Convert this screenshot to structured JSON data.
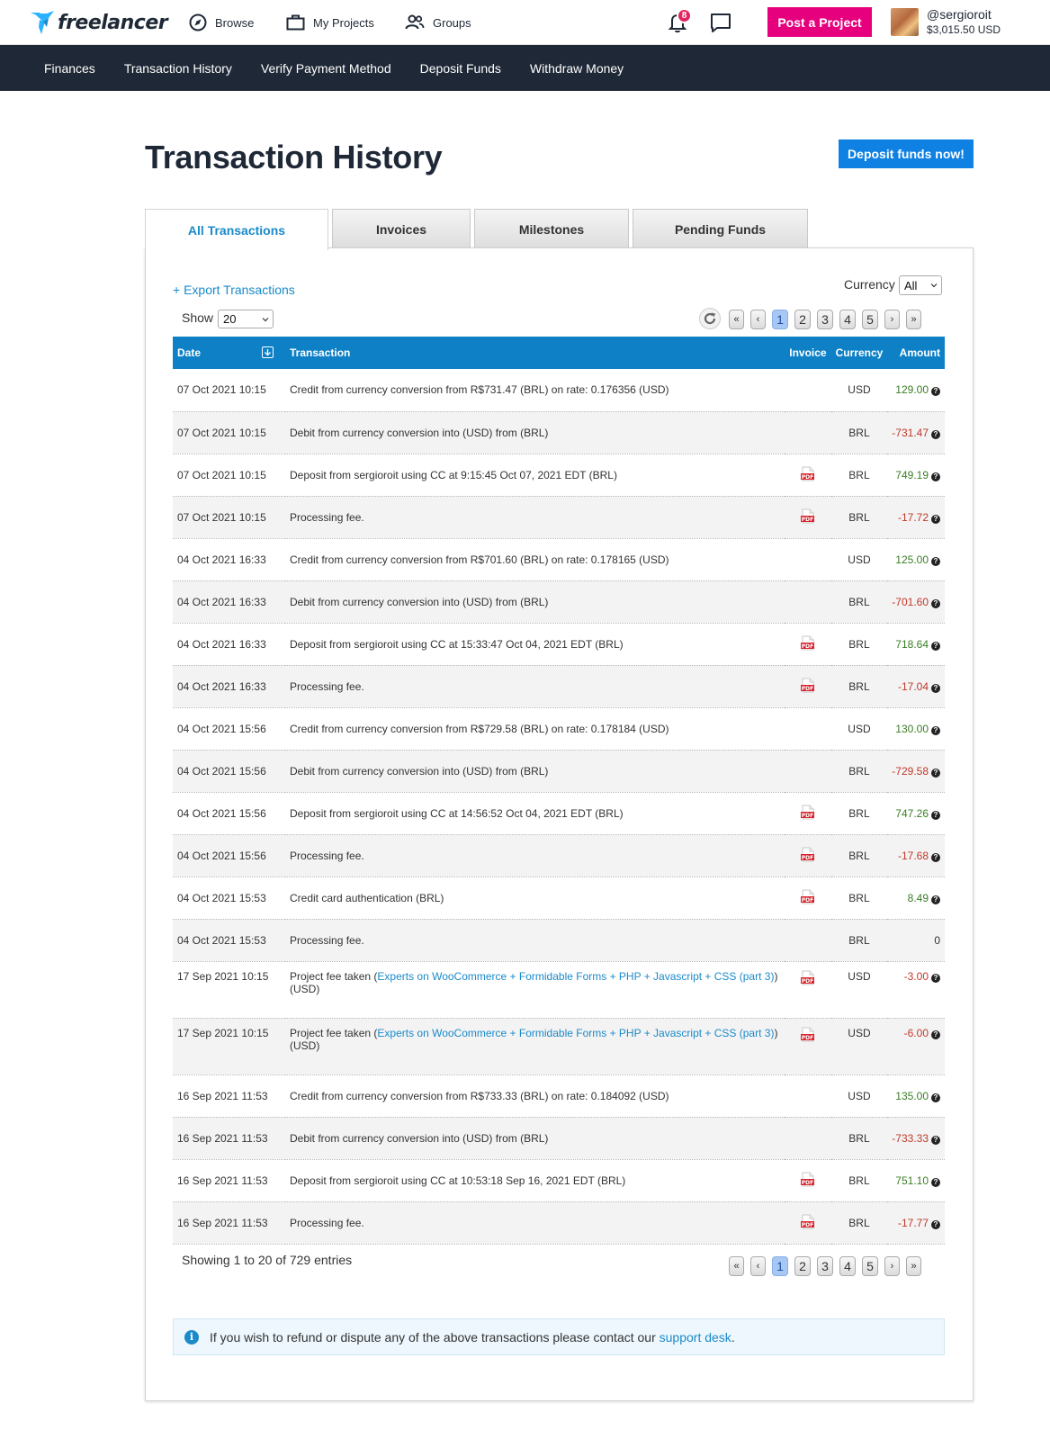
{
  "header": {
    "brand": "freelancer",
    "nav": [
      {
        "label": "Browse",
        "icon": "compass-icon"
      },
      {
        "label": "My Projects",
        "icon": "briefcase-icon"
      },
      {
        "label": "Groups",
        "icon": "groups-icon"
      }
    ],
    "notifications_count": "8",
    "post_project_label": "Post a Project",
    "username": "@sergioroit",
    "balance": "$3,015.50 USD"
  },
  "subnav": [
    "Finances",
    "Transaction History",
    "Verify Payment Method",
    "Deposit Funds",
    "Withdraw Money"
  ],
  "page": {
    "title": "Transaction History",
    "deposit_button": "Deposit funds now!"
  },
  "tabs": [
    "All Transactions",
    "Invoices",
    "Milestones",
    "Pending Funds"
  ],
  "controls": {
    "export_label": "+ Export Transactions",
    "currency_label": "Currency",
    "currency_value": "All",
    "show_label": "Show",
    "show_value": "20"
  },
  "pagination": {
    "first": "«",
    "prev": "‹",
    "pages": [
      "1",
      "2",
      "3",
      "4",
      "5"
    ],
    "current": "1",
    "next": "›",
    "last": "»"
  },
  "table": {
    "headers": {
      "date": "Date",
      "transaction": "Transaction",
      "invoice": "Invoice",
      "currency": "Currency",
      "amount": "Amount"
    },
    "rows": [
      {
        "date": "07 Oct 2021 10:15",
        "desc": "Credit from currency conversion from R$731.47 (BRL) on rate: 0.176356 (USD)",
        "pdf": false,
        "currency": "USD",
        "amount": "129.00",
        "sign": "pos",
        "help": true
      },
      {
        "date": "07 Oct 2021 10:15",
        "desc": "Debit from currency conversion into (USD) from (BRL)",
        "pdf": false,
        "currency": "BRL",
        "amount": "-731.47",
        "sign": "neg",
        "help": true
      },
      {
        "date": "07 Oct 2021 10:15",
        "desc": "Deposit from sergioroit using CC at 9:15:45 Oct 07, 2021 EDT (BRL)",
        "pdf": true,
        "currency": "BRL",
        "amount": "749.19",
        "sign": "pos",
        "help": true
      },
      {
        "date": "07 Oct 2021 10:15",
        "desc": "Processing fee.",
        "pdf": true,
        "currency": "BRL",
        "amount": "-17.72",
        "sign": "neg",
        "help": true
      },
      {
        "date": "04 Oct 2021 16:33",
        "desc": "Credit from currency conversion from R$701.60 (BRL) on rate: 0.178165 (USD)",
        "pdf": false,
        "currency": "USD",
        "amount": "125.00",
        "sign": "pos",
        "help": true
      },
      {
        "date": "04 Oct 2021 16:33",
        "desc": "Debit from currency conversion into (USD) from (BRL)",
        "pdf": false,
        "currency": "BRL",
        "amount": "-701.60",
        "sign": "neg",
        "help": true
      },
      {
        "date": "04 Oct 2021 16:33",
        "desc": "Deposit from sergioroit using CC at 15:33:47 Oct 04, 2021 EDT (BRL)",
        "pdf": true,
        "currency": "BRL",
        "amount": "718.64",
        "sign": "pos",
        "help": true
      },
      {
        "date": "04 Oct 2021 16:33",
        "desc": "Processing fee.",
        "pdf": true,
        "currency": "BRL",
        "amount": "-17.04",
        "sign": "neg",
        "help": true
      },
      {
        "date": "04 Oct 2021 15:56",
        "desc": "Credit from currency conversion from R$729.58 (BRL) on rate: 0.178184 (USD)",
        "pdf": false,
        "currency": "USD",
        "amount": "130.00",
        "sign": "pos",
        "help": true
      },
      {
        "date": "04 Oct 2021 15:56",
        "desc": "Debit from currency conversion into (USD) from (BRL)",
        "pdf": false,
        "currency": "BRL",
        "amount": "-729.58",
        "sign": "neg",
        "help": true
      },
      {
        "date": "04 Oct 2021 15:56",
        "desc": "Deposit from sergioroit using CC at 14:56:52 Oct 04, 2021 EDT (BRL)",
        "pdf": true,
        "currency": "BRL",
        "amount": "747.26",
        "sign": "pos",
        "help": true
      },
      {
        "date": "04 Oct 2021 15:56",
        "desc": "Processing fee.",
        "pdf": true,
        "currency": "BRL",
        "amount": "-17.68",
        "sign": "neg",
        "help": true
      },
      {
        "date": "04 Oct 2021 15:53",
        "desc": "Credit card authentication (BRL)",
        "pdf": true,
        "currency": "BRL",
        "amount": "8.49",
        "sign": "pos",
        "help": true
      },
      {
        "date": "04 Oct 2021 15:53",
        "desc": "Processing fee.",
        "pdf": false,
        "currency": "BRL",
        "amount": "0",
        "sign": "zero",
        "help": false
      },
      {
        "date": "17 Sep 2021 10:15",
        "desc_prefix": "Project fee taken (",
        "desc_link": "Experts on WooCommerce + Formidable Forms + PHP + Javascript + CSS (part 3)",
        "desc_suffix": ") (USD)",
        "pdf": true,
        "currency": "USD",
        "amount": "-3.00",
        "sign": "neg",
        "help": true
      },
      {
        "date": "17 Sep 2021 10:15",
        "desc_prefix": "Project fee taken (",
        "desc_link": "Experts on WooCommerce + Formidable Forms + PHP + Javascript + CSS (part 3)",
        "desc_suffix": ") (USD)",
        "pdf": true,
        "currency": "USD",
        "amount": "-6.00",
        "sign": "neg",
        "help": true
      },
      {
        "date": "16 Sep 2021 11:53",
        "desc": "Credit from currency conversion from R$733.33 (BRL) on rate: 0.184092 (USD)",
        "pdf": false,
        "currency": "USD",
        "amount": "135.00",
        "sign": "pos",
        "help": true
      },
      {
        "date": "16 Sep 2021 11:53",
        "desc": "Debit from currency conversion into (USD) from (BRL)",
        "pdf": false,
        "currency": "BRL",
        "amount": "-733.33",
        "sign": "neg",
        "help": true
      },
      {
        "date": "16 Sep 2021 11:53",
        "desc": "Deposit from sergioroit using CC at 10:53:18 Sep 16, 2021 EDT (BRL)",
        "pdf": true,
        "currency": "BRL",
        "amount": "751.10",
        "sign": "pos",
        "help": true
      },
      {
        "date": "16 Sep 2021 11:53",
        "desc": "Processing fee.",
        "pdf": true,
        "currency": "BRL",
        "amount": "-17.77",
        "sign": "neg",
        "help": true
      }
    ]
  },
  "footer": {
    "showing": "Showing 1 to 20 of 729 entries",
    "notice_prefix": "If you wish to refund or dispute any of the above transactions please contact our ",
    "notice_link": "support desk",
    "notice_suffix": "."
  },
  "colors": {
    "brand_dark": "#1f2836",
    "post_button": "#e6007e",
    "primary_blue": "#0e81e3",
    "table_header": "#0e81c6",
    "positive": "#3b7d25",
    "negative": "#c0392b"
  }
}
